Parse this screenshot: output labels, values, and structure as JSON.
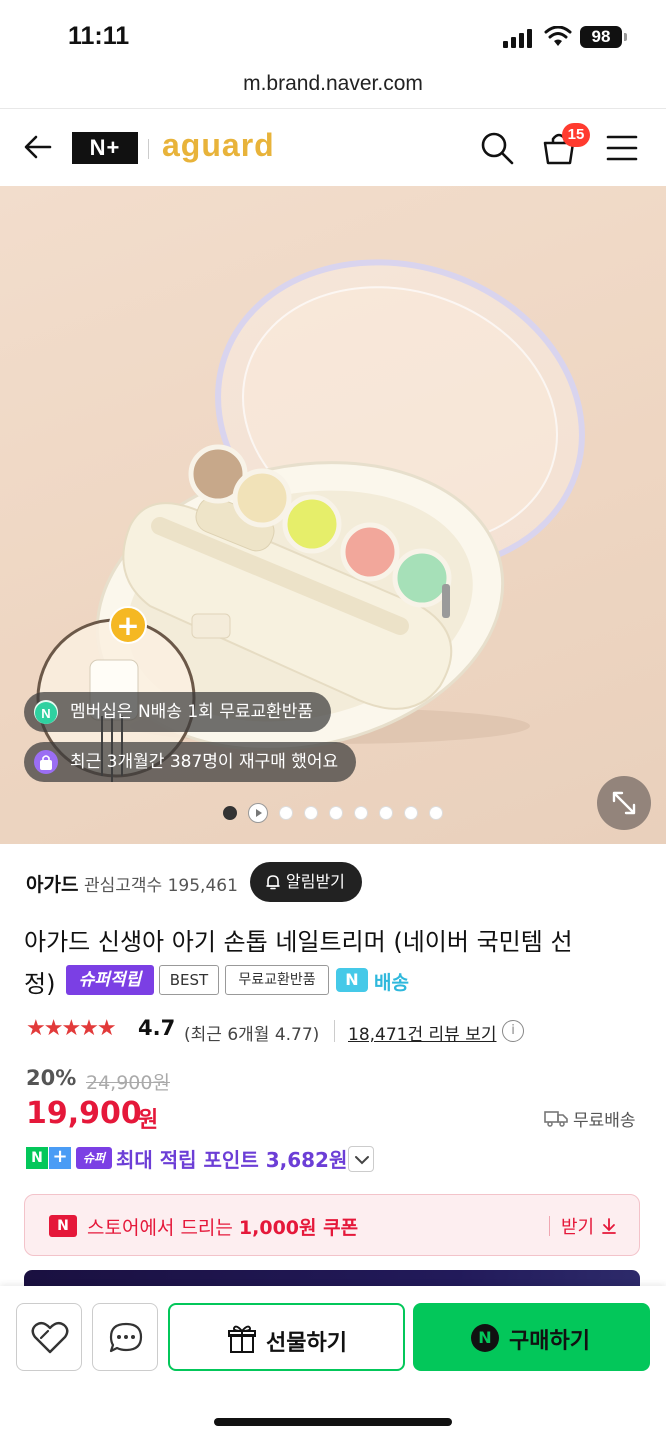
{
  "status_bar": {
    "time": "11:11",
    "battery": "98"
  },
  "url": "m.brand.naver.com",
  "header": {
    "nplus_logo": "N+",
    "brand": "aguard",
    "cart_count": "15"
  },
  "hero": {
    "chips": [
      {
        "icon": "N",
        "text": "멤버십은 N배송 1회 무료교환반품"
      },
      {
        "icon": "bag",
        "text": "최근 3개월간 387명이 재구매 했어요"
      }
    ],
    "plus_marker": "+",
    "slides_total": 9,
    "slide_active": 1
  },
  "store": {
    "name": "아가드",
    "followers": "관심고객수 195,461",
    "alarm_label": "알림받기"
  },
  "product": {
    "title_line1": "아가드 신생아 아기 손톱 네일트리머 (네이버 국민템 선",
    "title_line2": "정)",
    "badge_super": "슈퍼적립",
    "badge_best": "BEST",
    "badge_free": "무료교환반품",
    "delivery_icon": "N",
    "delivery_label": "배송"
  },
  "rating": {
    "stars": "★★★★★",
    "score": "4.7",
    "recent": "(최근 6개월 4.77)",
    "review_link": "18,471건 리뷰 보기",
    "info": "i"
  },
  "price": {
    "discount": "20%",
    "original": "24,900원",
    "sale": "19,900",
    "unit": "원",
    "shipping": "무료배송"
  },
  "points": {
    "n_badge": "N",
    "plus_badge": "+",
    "super_badge": "슈퍼",
    "text": "최대 적립 포인트 3,682원"
  },
  "coupon": {
    "icon": "N",
    "text_prefix": "스토어에서 드리는 ",
    "amount": "1,000원 쿠폰",
    "get_label": "받기"
  },
  "bottom": {
    "gift_label": "선물하기",
    "buy_icon": "N",
    "buy_label": "구매하기"
  },
  "colors": {
    "naver_green": "#03c75a",
    "price_red": "#e5183a",
    "super_purple": "#7b3fe4",
    "brand_yellow": "#e8b33a"
  }
}
